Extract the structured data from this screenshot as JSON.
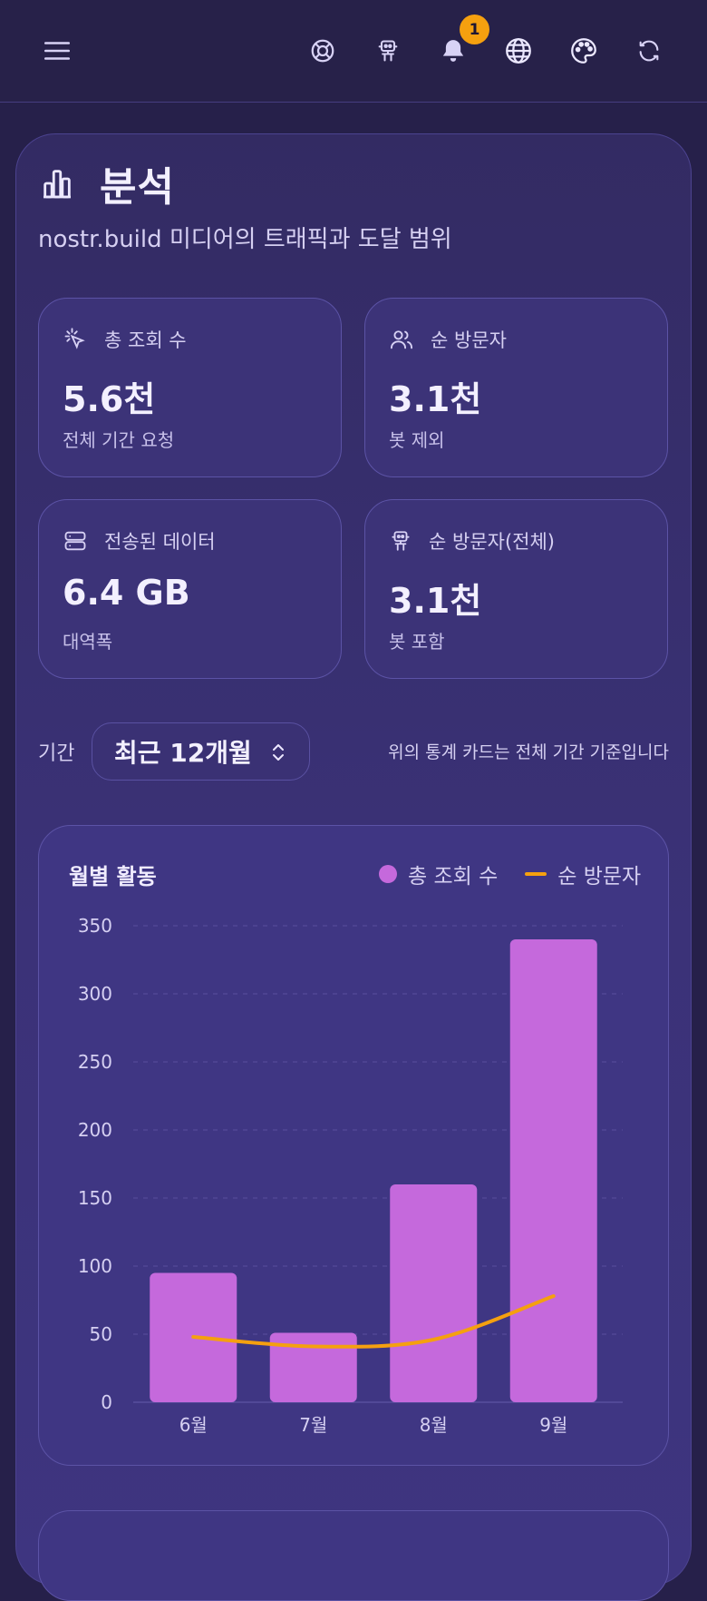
{
  "topbar": {
    "menu_icon": "menu-icon",
    "support_icon": "lifebuoy-icon",
    "bot_icon": "robot-icon",
    "bell_icon": "bell-icon",
    "notification_count": "1",
    "globe_icon": "globe-icon",
    "palette_icon": "palette-icon",
    "refresh_icon": "refresh-icon"
  },
  "page": {
    "title": "분석",
    "subtitle": "nostr.build 미디어의 트래픽과 도달 범위"
  },
  "stats": [
    {
      "label": "총 조회 수",
      "value": "5.6천",
      "note": "전체 기간 요청",
      "icon": "cursor-click-icon"
    },
    {
      "label": "순 방문자",
      "value": "3.1천",
      "note": "봇 제외",
      "icon": "users-icon"
    },
    {
      "label": "전송된 데이터",
      "value": "6.4 GB",
      "note": "대역폭",
      "icon": "server-icon"
    },
    {
      "label": "순 방문자(전체)",
      "value": "3.1천",
      "note": "봇 포함",
      "icon": "robot-icon"
    }
  ],
  "period": {
    "label": "기간",
    "value": "최근 12개월",
    "note": "위의 통계 카드는 전체 기간 기준입니다"
  },
  "chart": {
    "title": "월별 활동",
    "legend_views": "총 조회 수",
    "legend_visitors": "순 방문자"
  },
  "colors": {
    "bar": "#c569dc",
    "line": "#f5a00f",
    "badge": "#f5a00f",
    "background": "#26204a"
  },
  "chart_data": {
    "type": "bar",
    "title": "월별 활동",
    "categories": [
      "6월",
      "7월",
      "8월",
      "9월"
    ],
    "series": [
      {
        "name": "총 조회 수",
        "type": "bar",
        "values": [
          95,
          51,
          160,
          340
        ]
      },
      {
        "name": "순 방문자",
        "type": "line",
        "values": [
          48,
          41,
          46,
          78
        ]
      }
    ],
    "y_ticks": [
      0,
      50,
      100,
      150,
      200,
      250,
      300,
      350
    ],
    "ylim": [
      0,
      350
    ],
    "grid": true,
    "legend": "top-right"
  }
}
